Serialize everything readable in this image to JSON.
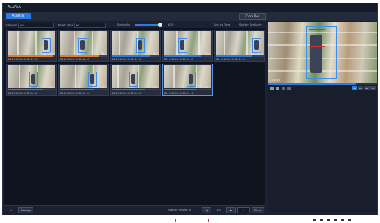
{
  "app": {
    "title": "AcuPick"
  },
  "tabs": [
    {
      "label": "AcuPick"
    }
  ],
  "header": {
    "close_label": "Close Res"
  },
  "filters": {
    "channel_label": "Channel",
    "channel_value": "All",
    "target_label": "Target Filter",
    "target_value": "All",
    "similarity_label": "Similarity",
    "similarity_value": "80%",
    "sort_time_label": "Sort by Time",
    "sort_sim_label": "Sort by Similarity"
  },
  "results": [
    {
      "pct": "99%",
      "timestamp": "D1 2019-04-18 11:19:01",
      "bar": 0.95,
      "bar_color": "#e07f2b"
    },
    {
      "pct": "91%",
      "timestamp": "D1 2019-04-18 11:18:07",
      "bar": 0.82,
      "bar_color": "#e07f2b"
    },
    {
      "pct": "91%",
      "timestamp": "D1 2019-04-18 11:19:08",
      "bar": 0.8,
      "bar_color": "#2b7be0"
    },
    {
      "pct": "90%",
      "timestamp": "D1 2019-04-18 11:19:37",
      "bar": 0.78,
      "bar_color": "#2b7be0"
    },
    {
      "pct": "90%",
      "timestamp": "D1 2019-04-18 11:19:44",
      "bar": 0.76,
      "bar_color": "#2b7be0"
    },
    {
      "pct": "89%",
      "timestamp": "D1 2019-04-18 11:20:08",
      "bar": 0.74,
      "bar_color": "#2b7be0"
    },
    {
      "pct": "88%",
      "timestamp": "D1 2019-04-18 11:20:49",
      "bar": 0.72,
      "bar_color": "#2b7be0"
    },
    {
      "pct": "88%",
      "timestamp": "D1 2019-04-18 11:20:51",
      "bar": 0.7,
      "bar_color": "#2b7be0"
    },
    {
      "pct": "87%",
      "timestamp": "D1 2019-04-18 11:21:11",
      "bar": 0.68,
      "bar_color": "#2b7be0"
    }
  ],
  "footer": {
    "backup_label": "Backup",
    "search_results_label": "Search Results: 9",
    "page_current": "1/1",
    "goto_value": "1",
    "goto_label": "Go to"
  },
  "player": {
    "time": "11:19:01",
    "progress": 0.8,
    "speeds": [
      "1X",
      "2X",
      "4X",
      "8X"
    ],
    "colors": {
      "accent": "#2b7be0",
      "alert": "#e07f2b",
      "box": "#3b8ef0"
    }
  }
}
